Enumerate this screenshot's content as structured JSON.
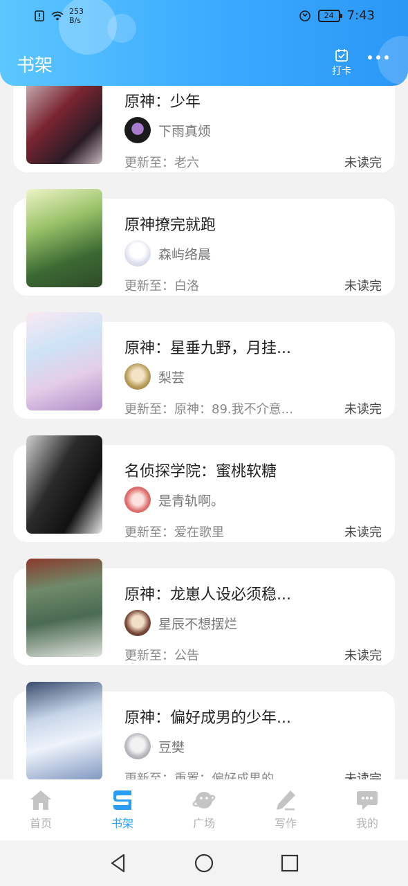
{
  "status_bar": {
    "speed_value": "253",
    "speed_unit": "B/s",
    "battery": "24",
    "time": "7:43"
  },
  "header": {
    "title": "书架",
    "checkin_label": "打卡"
  },
  "books": [
    {
      "title": "原神：少年",
      "author": "下雨真烦",
      "update": "更新至：老六",
      "status": "未读完"
    },
    {
      "title": "原神撩完就跑",
      "author": "森屿络晨",
      "update": "更新至：白洛",
      "status": "未读完"
    },
    {
      "title": "原神：星垂九野，月挂...",
      "author": "梨芸",
      "update": "更新至：原神：89.我不介意...",
      "status": "未读完"
    },
    {
      "title": "名侦探学院：蜜桃软糖",
      "author": "是青轨啊。",
      "update": "更新至：爱在歌里",
      "status": "未读完"
    },
    {
      "title": "原神：龙崽人设必须稳...",
      "author": "星辰不想摆烂",
      "update": "更新至：公告",
      "status": "未读完"
    },
    {
      "title": "原神：偏好成男的少年...",
      "author": "豆樊",
      "update": "更新至：重置：偏好成男的...",
      "status": "未读完"
    }
  ],
  "nav": [
    {
      "label": "首页",
      "icon": "home-icon"
    },
    {
      "label": "书架",
      "icon": "bookshelf-icon"
    },
    {
      "label": "广场",
      "icon": "planet-icon"
    },
    {
      "label": "写作",
      "icon": "pen-icon"
    },
    {
      "label": "我的",
      "icon": "chat-icon"
    }
  ],
  "colors": {
    "accent": "#2a9df4",
    "header_start": "#5cc6ff",
    "header_end": "#2b97f6",
    "inactive": "#b3b3b3"
  }
}
